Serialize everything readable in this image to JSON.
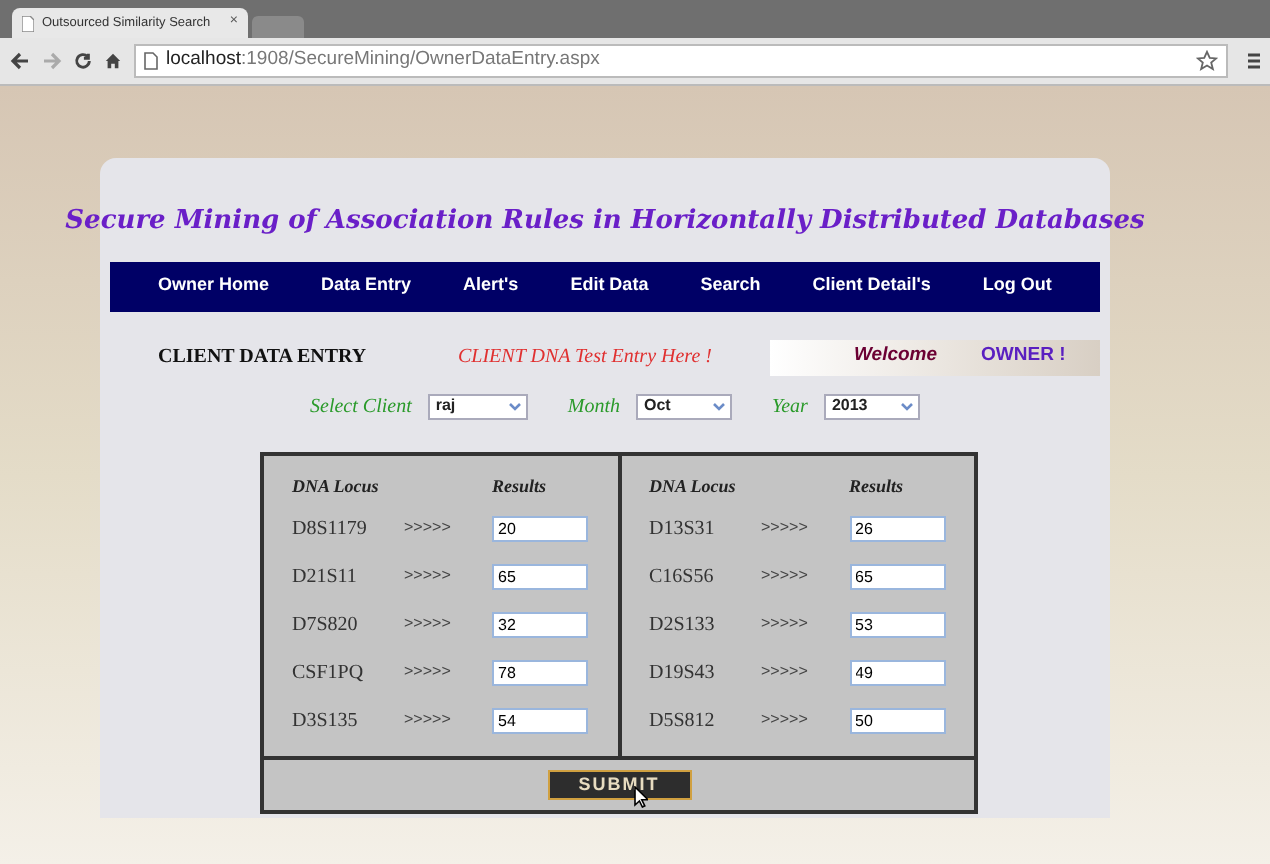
{
  "browser": {
    "tab_title": "Outsourced Similarity Search",
    "tab_close": "×",
    "url_host": "localhost",
    "url_path": ":1908/SecureMining/OwnerDataEntry.aspx"
  },
  "page": {
    "title": "Secure Mining of Association Rules in Horizontally Distributed Databases",
    "nav": [
      "Owner Home",
      "Data Entry",
      "Alert's",
      "Edit Data",
      "Search",
      "Client Detail's",
      "Log Out"
    ],
    "section_title": "CLIENT DATA ENTRY",
    "section_hint": "CLIENT DNA Test Entry Here !",
    "welcome": "Welcome",
    "user": "OWNER !",
    "filters": [
      {
        "label": "Select Client",
        "value": "raj"
      },
      {
        "label": "Month",
        "value": "Oct"
      },
      {
        "label": "Year",
        "value": "2013"
      }
    ],
    "columns": [
      {
        "locus_header": "DNA Locus",
        "results_header": "Results",
        "rows": [
          {
            "locus": "D8S1179",
            "arrow": ">>>>>",
            "result": "20"
          },
          {
            "locus": "D21S11",
            "arrow": ">>>>>",
            "result": "65"
          },
          {
            "locus": "D7S820",
            "arrow": ">>>>>",
            "result": "32"
          },
          {
            "locus": "CSF1PQ",
            "arrow": ">>>>>",
            "result": "78"
          },
          {
            "locus": "D3S135",
            "arrow": ">>>>>",
            "result": "54"
          }
        ]
      },
      {
        "locus_header": "DNA Locus",
        "results_header": "Results",
        "rows": [
          {
            "locus": "D13S31",
            "arrow": ">>>>>",
            "result": "26"
          },
          {
            "locus": "C16S56",
            "arrow": ">>>>>",
            "result": "65"
          },
          {
            "locus": "D2S133",
            "arrow": ">>>>>",
            "result": "53"
          },
          {
            "locus": "D19S43",
            "arrow": ">>>>>",
            "result": "49"
          },
          {
            "locus": "D5S812",
            "arrow": ">>>>>",
            "result": "50"
          }
        ]
      }
    ],
    "submit": "SUBMIT"
  }
}
